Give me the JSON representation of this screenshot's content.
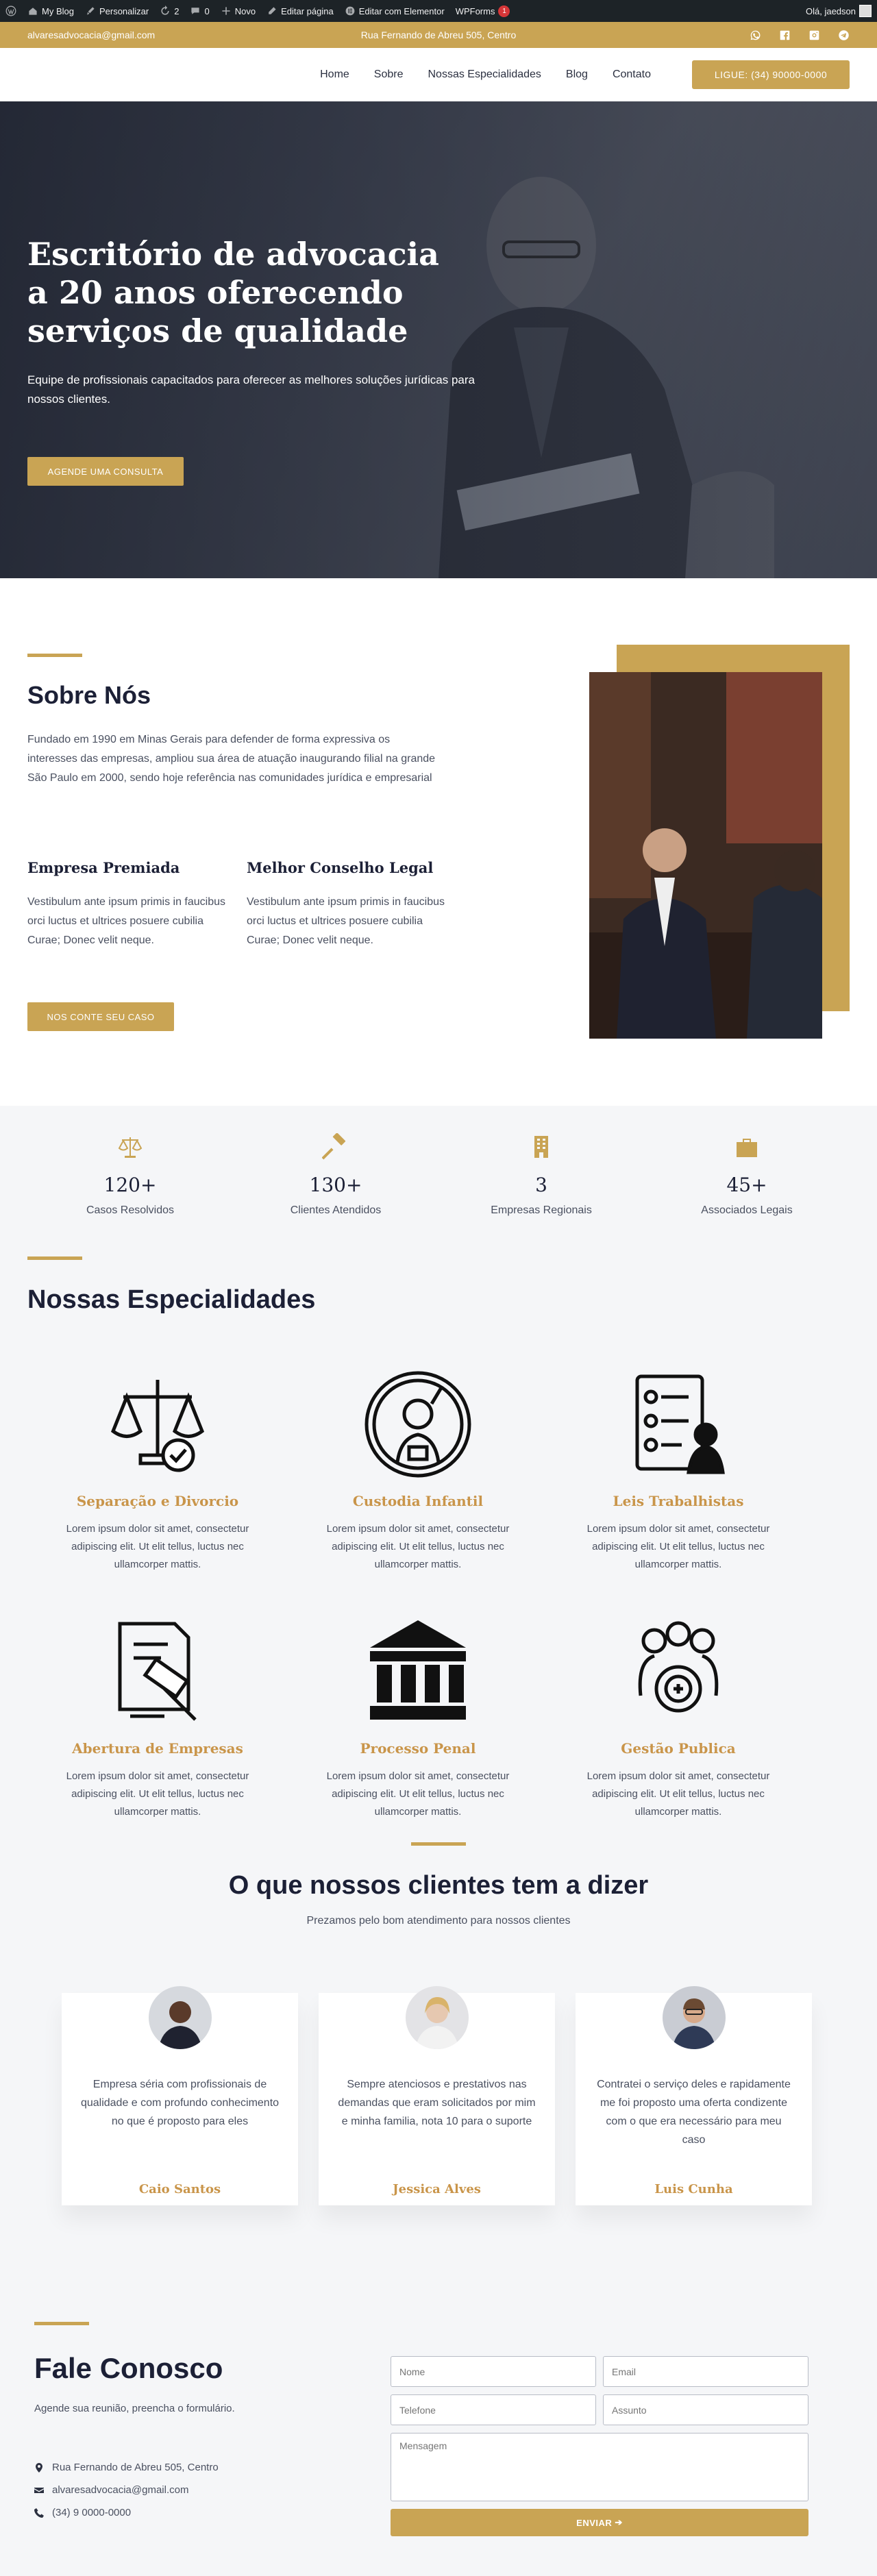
{
  "admin_bar": {
    "items": [
      {
        "icon": "wordpress-icon",
        "label": ""
      },
      {
        "icon": "home-icon",
        "label": "My Blog"
      },
      {
        "icon": "brush-icon",
        "label": "Personalizar"
      },
      {
        "icon": "update-icon",
        "label": "2"
      },
      {
        "icon": "comment-icon",
        "label": "0"
      },
      {
        "icon": "plus-icon",
        "label": "Novo"
      },
      {
        "icon": "pencil-icon",
        "label": "Editar página"
      },
      {
        "icon": "elementor-icon",
        "label": "Editar com Elementor"
      }
    ],
    "wpforms_label": "WPForms",
    "wpforms_badge": "1",
    "greeting": "Olá, jaedson"
  },
  "topbar": {
    "email": "alvaresadvocacia@gmail.com",
    "address": "Rua Fernando de Abreu 505, Centro",
    "socials": [
      "whatsapp-icon",
      "facebook-icon",
      "instagram-icon",
      "telegram-icon"
    ]
  },
  "header": {
    "nav": [
      "Home",
      "Sobre",
      "Nossas Especialidades",
      "Blog",
      "Contato"
    ],
    "cta": "LIGUE: (34) 90000-0000"
  },
  "hero": {
    "title_lines": [
      "Escritório de advocacia",
      "a 20 anos oferecendo",
      "serviços de qualidade"
    ],
    "text": "Equipe de profissionais capacitados para oferecer as melhores soluções jurídicas para nossos clientes.",
    "button": "AGENDE UMA CONSULTA"
  },
  "about": {
    "title": "Sobre Nós",
    "text": "Fundado em 1990 em Minas Gerais para defender de forma expressiva os interesses das empresas, ampliou sua área de atuação inaugurando filial na grande São Paulo em 2000, sendo hoje referência nas comunidades jurídica e empresarial",
    "col1_title": "Empresa Premiada",
    "col1_text": "Vestibulum ante ipsum primis in faucibus orci luctus et ultrices posuere cubilia Curae; Donec velit neque.",
    "col2_title": "Melhor Conselho Legal",
    "col2_text": "Vestibulum ante ipsum primis in faucibus orci luctus et ultrices posuere cubilia Curae; Donec velit neque.",
    "button": "NOS CONTE SEU CASO"
  },
  "stats": [
    {
      "icon": "scales-icon",
      "value": "120+",
      "label": "Casos Resolvidos"
    },
    {
      "icon": "gavel-icon",
      "value": "130+",
      "label": "Clientes Atendidos"
    },
    {
      "icon": "building-icon",
      "value": "3",
      "label": "Empresas Regionais"
    },
    {
      "icon": "briefcase-icon",
      "value": "45+",
      "label": "Associados Legais"
    }
  ],
  "services": {
    "title": "Nossas Especialidades",
    "items": [
      {
        "icon": "justice-scale-icon",
        "title": "Separação e Divorcio",
        "text": "Lorem ipsum dolor sit amet, consectetur adipiscing elit. Ut elit tellus, luctus nec ullamcorper mattis."
      },
      {
        "icon": "child-icon",
        "title": "Custodia Infantil",
        "text": "Lorem ipsum dolor sit amet, consectetur adipiscing elit. Ut elit tellus, luctus nec ullamcorper mattis."
      },
      {
        "icon": "checklist-worker-icon",
        "title": "Leis Trabalhistas",
        "text": "Lorem ipsum dolor sit amet, consectetur adipiscing elit. Ut elit tellus, luctus nec ullamcorper mattis."
      },
      {
        "icon": "document-gavel-icon",
        "title": "Abertura de Empresas",
        "text": "Lorem ipsum dolor sit amet, consectetur adipiscing elit. Ut elit tellus, luctus nec ullamcorper mattis."
      },
      {
        "icon": "courthouse-icon",
        "title": "Processo Penal",
        "text": "Lorem ipsum dolor sit amet, consectetur adipiscing elit. Ut elit tellus, luctus nec ullamcorper mattis."
      },
      {
        "icon": "people-gear-icon",
        "title": "Gestão Publica",
        "text": "Lorem ipsum dolor sit amet, consectetur adipiscing elit. Ut elit tellus, luctus nec ullamcorper mattis."
      }
    ]
  },
  "testimonials": {
    "title": "O que nossos clientes tem a dizer",
    "subtitle": "Prezamos pelo bom atendimento para nossos clientes",
    "items": [
      {
        "quote": "Empresa séria com profissionais de qualidade e com profundo conhecimento no que é proposto para eles",
        "name": "Caio Santos"
      },
      {
        "quote": "Sempre atenciosos e prestativos nas demandas que eram solicitados por mim e minha familia, nota 10 para o suporte",
        "name": "Jessica Alves"
      },
      {
        "quote": "Contratei o serviço deles e rapidamente me foi proposto uma oferta condizente com o que era necessário para meu caso",
        "name": "Luis Cunha"
      }
    ]
  },
  "contact": {
    "title": "Fale Conosco",
    "subtitle": "Agende sua reunião, preencha o formulário.",
    "address": "Rua Fernando de Abreu 505, Centro",
    "email": "alvaresadvocacia@gmail.com",
    "phone": "(34) 9 0000-0000",
    "placeholders": {
      "name": "Nome",
      "email": "Email",
      "phone": "Telefone",
      "subject": "Assunto",
      "message": "Mensagem"
    },
    "submit": "ENVIAR"
  },
  "colors": {
    "gold": "#c9a454",
    "dark": "#1c2036",
    "admin_bar": "#1d2327"
  }
}
